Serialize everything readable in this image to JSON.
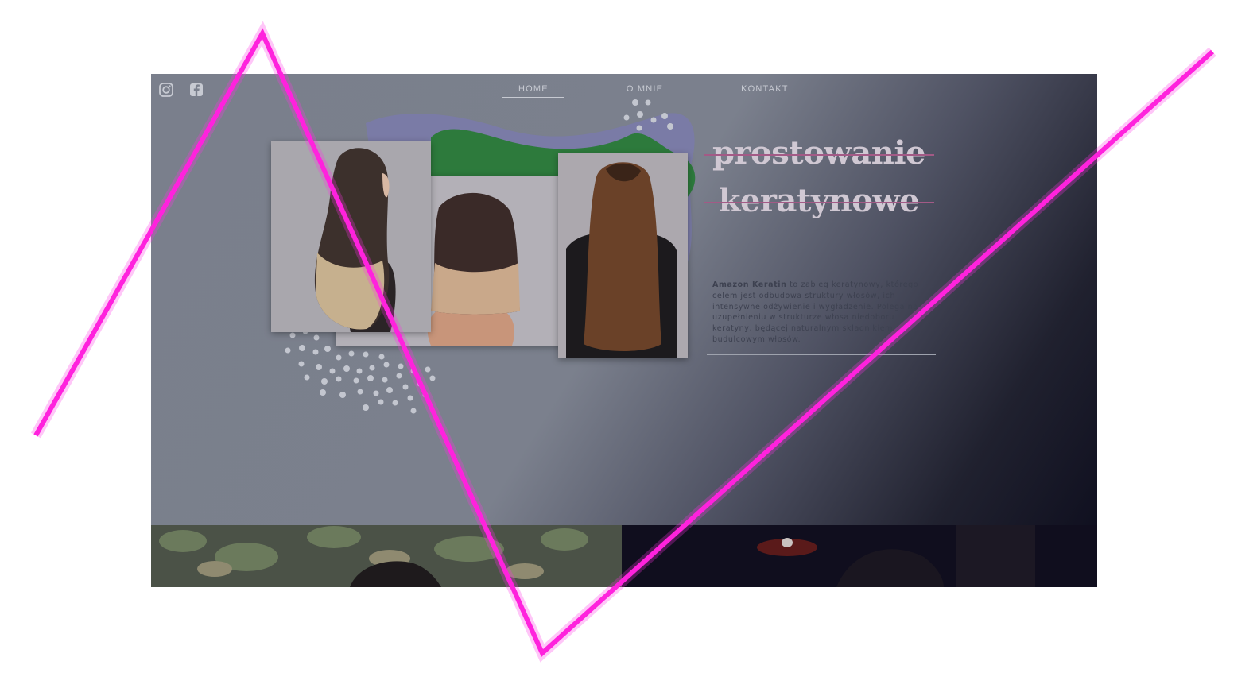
{
  "nav": {
    "items": [
      {
        "label": "HOME",
        "active": true
      },
      {
        "label": "O MNIE",
        "active": false
      },
      {
        "label": "KONTAKT",
        "active": false
      }
    ]
  },
  "social": {
    "icons": [
      "instagram-icon",
      "facebook-icon"
    ]
  },
  "hero": {
    "title_line1": "prostowanie",
    "title_line2": "keratynowe",
    "desc_brand": "Amazon Keratin",
    "desc_text": " to zabieg keratynowy, którego celem jest odbudowa struktury włosów, ich intensywne odżywienie i wygładzenie. Polega na uzupełnieniu w strukturze włosa niedoboru keratyny, będącej naturalnym składnikiem budulcowym włosów."
  },
  "colors": {
    "blob_purple": "#7a7ba6",
    "blob_green": "#2d7a3c",
    "title": "#d0c8d3",
    "strike": "#a35a86",
    "annotation_line": "#ff22dd"
  }
}
